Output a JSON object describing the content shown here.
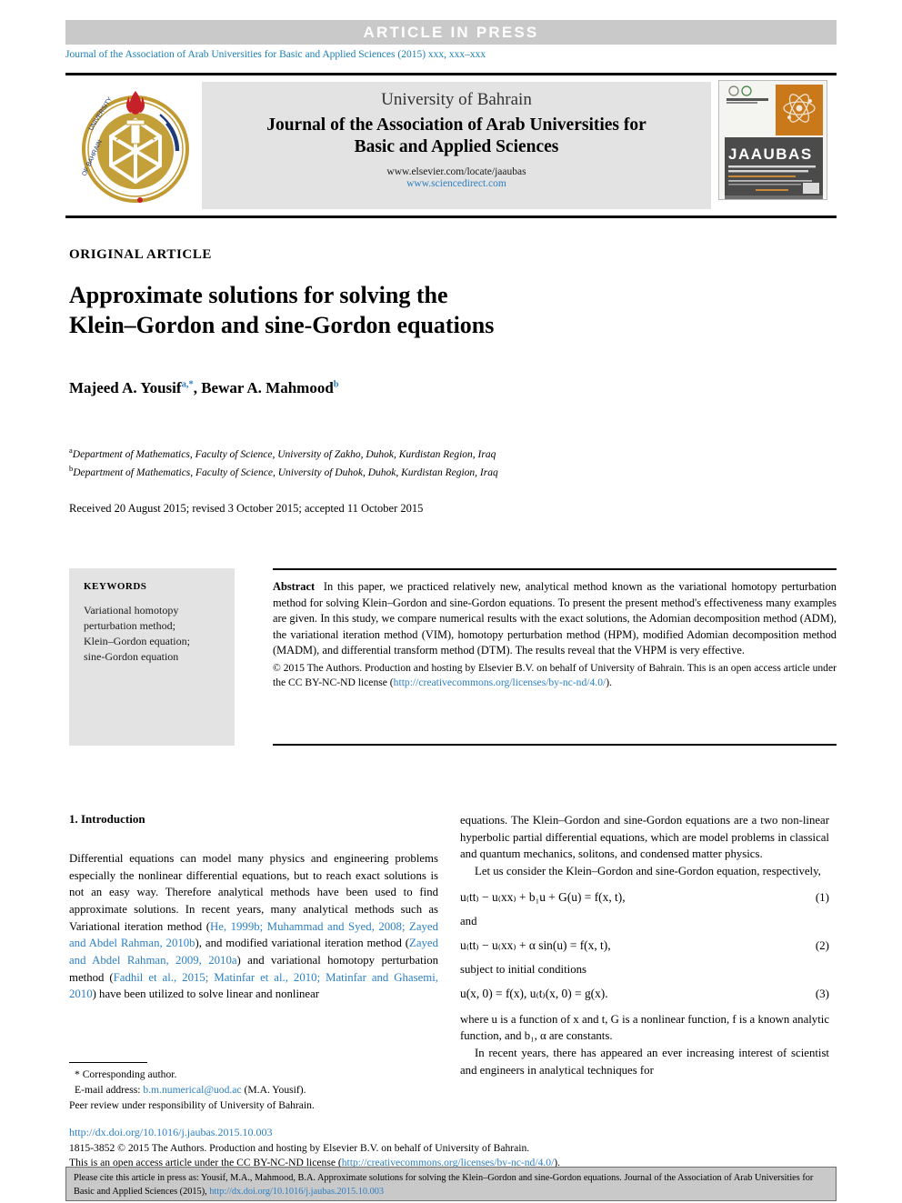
{
  "banner": {
    "text": "ARTICLE  IN  PRESS"
  },
  "running_head": {
    "text": "Journal of the Association of Arab Universities for Basic and Applied Sciences (2015) xxx, xxx–xxx"
  },
  "masthead": {
    "university": "University of Bahrain",
    "journal_title_line1": "Journal of the Association of Arab Universities for",
    "journal_title_line2": "Basic and Applied Sciences",
    "url_elsevier": "www.elsevier.com/locate/jaaubas",
    "url_sciencedirect": "www.sciencedirect.com",
    "logo_alt": "University of Bahrain emblem",
    "cover_title": "JAAUBAS",
    "cover_subtitle": "Journal of the Association of Arab Universities for Basic and Applied Sciences"
  },
  "article": {
    "type_label": "ORIGINAL ARTICLE",
    "title_line1": "Approximate solutions for solving the",
    "title_line2": "Klein–Gordon and sine-Gordon equations",
    "authors": [
      {
        "name": "Majeed A. Yousif",
        "marks": "a,*"
      },
      {
        "name": "Bewar A. Mahmood",
        "marks": "b"
      }
    ],
    "authors_separator": ", ",
    "affiliations": [
      {
        "mark": "a",
        "text": "Department of Mathematics, Faculty of Science, University of Zakho, Duhok, Kurdistan Region, Iraq"
      },
      {
        "mark": "b",
        "text": "Department of Mathematics, Faculty of Science, University of Duhok, Duhok, Kurdistan Region, Iraq"
      }
    ],
    "history": "Received 20 August 2015; revised 3 October 2015; accepted 11 October 2015"
  },
  "keywords": {
    "heading": "KEYWORDS",
    "items_text": "Variational homotopy perturbation method; Klein–Gordon equation; sine-Gordon equation",
    "items": [
      "Variational homotopy perturbation method;",
      "Klein–Gordon equation;",
      "sine-Gordon equation"
    ]
  },
  "abstract": {
    "label": "Abstract",
    "body": "In this paper, we practiced relatively new, analytical method known as the variational homotopy perturbation method for solving Klein–Gordon and sine-Gordon equations. To present the present method's effectiveness many examples are given. In this study, we compare numerical results with the exact solutions, the Adomian decomposition method (ADM), the variational iteration method (VIM), homotopy perturbation method (HPM), modified Adomian decomposition method (MADM), and differential transform method (DTM). The results reveal that the VHPM is very effective.",
    "copyright_prefix": "© 2015 The Authors. Production and hosting by Elsevier B.V. on behalf of University of Bahrain.  This is an open access article under the CC BY-NC-ND license (",
    "license_url": "http://creativecommons.org/licenses/by-nc-nd/4.0/",
    "copyright_suffix": ")."
  },
  "body_left": {
    "section_heading": "1. Introduction",
    "para1_a": "Differential equations can model many physics and engineering problems especially the nonlinear differential equations, but to reach exact solutions is not an easy way. Therefore analytical methods have been used to find approximate solutions. In recent years, many analytical methods such as Variational iteration method (",
    "cite1": "He, 1999b; Muhammad and Syed, 2008; Zayed and Abdel Rahman, 2010b",
    "para1_b": "), and modified variational iteration method (",
    "cite2": "Zayed and Abdel Rahman, 2009, 2010a",
    "para1_c": ") and variational homotopy perturbation method (",
    "cite3": "Fadhil et al., 2015; Matinfar et al., 2010; Matinfar and Ghasemi, 2010",
    "para1_d": ") have been utilized to solve linear and nonlinear"
  },
  "body_right": {
    "para1": "equations. The Klein–Gordon and sine-Gordon equations are a two non-linear hyperbolic partial differential equations, which are model problems in classical and quantum mechanics, solitons, and condensed matter physics.",
    "para2": "Let us consider the Klein–Gordon and sine-Gordon equation, respectively,",
    "eq1": "u₍tt₎ − u₍xx₎ + b₁u + G(u) = f(x, t),",
    "eq1_num": "(1)",
    "and_label": "and",
    "eq2": "u₍tt₎ − u₍xx₎ + α sin(u) = f(x, t),",
    "eq2_num": "(2)",
    "subject_label": "subject to initial conditions",
    "eq3": "u(x, 0) = f(x),   u₍t₎(x, 0) = g(x).",
    "eq3_num": "(3)",
    "para3": "where u is a function of x and t, G is a nonlinear function, f is a known analytic function, and b₁, α are constants.",
    "para4": "In recent years, there has appeared an ever increasing interest of scientist and engineers in analytical techniques for"
  },
  "footnote": {
    "corresponding": "* Corresponding author.",
    "email_label": "E-mail address:",
    "email": "b.m.numerical@uod.ac",
    "email_owner": "(M.A. Yousif).",
    "peer_review": "Peer review under responsibility of University of Bahrain.",
    "doi": "http://dx.doi.org/10.1016/j.jaubas.2015.10.003",
    "copyright_line1": "1815-3852 © 2015 The Authors. Production and hosting by Elsevier B.V. on behalf of University of Bahrain.",
    "copyright_line2_prefix": "This is an open access article under the CC BY-NC-ND license (",
    "copyright_license_url": "http://creativecommons.org/licenses/by-nc-nd/4.0/",
    "copyright_line2_suffix": ")."
  },
  "cite_box": {
    "text_prefix": "Please cite this article in press as: Yousif, M.A., Mahmood, B.A. Approximate solutions for solving the Klein–Gordon and sine-Gordon equations. Journal of the Association of Arab Universities for Basic and Applied Sciences (2015), ",
    "link": "http://dx.doi.org/10.1016/j.jaubas.2015.10.003"
  },
  "colors": {
    "link": "#2b7fc4",
    "banner_bg": "#c9c9c9",
    "grey_panel": "#e3e3e3",
    "logo_gold": "#c19a31",
    "logo_blue": "#1f3a7a",
    "logo_red": "#c62128",
    "cover_orange": "#c9781a",
    "cover_dark": "#4a4a4a"
  }
}
